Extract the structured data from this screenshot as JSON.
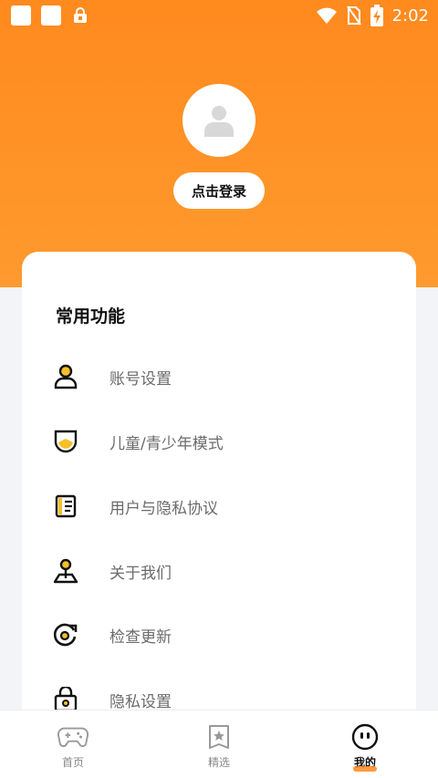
{
  "status_bar": {
    "time": "2:02",
    "icons": [
      "notification-square-icon",
      "notification-square-icon",
      "lock-app-icon",
      "wifi-icon",
      "no-sim-icon",
      "battery-charging-icon"
    ]
  },
  "profile": {
    "login_label": "点击登录",
    "avatar_icon": "user-placeholder-icon"
  },
  "common_functions": {
    "title": "常用功能",
    "items": [
      {
        "label": "账号设置",
        "icon": "person-icon"
      },
      {
        "label": "儿童/青少年模式",
        "icon": "shield-icon"
      },
      {
        "label": "用户与隐私协议",
        "icon": "document-icon"
      },
      {
        "label": "关于我们",
        "icon": "location-pin-icon"
      },
      {
        "label": "检查更新",
        "icon": "refresh-icon"
      },
      {
        "label": "隐私设置",
        "icon": "lock-icon"
      }
    ]
  },
  "tab_bar": {
    "tabs": [
      {
        "label": "首页",
        "icon": "gamepad-icon",
        "active": false
      },
      {
        "label": "精选",
        "icon": "star-card-icon",
        "active": false
      },
      {
        "label": "我的",
        "icon": "face-icon",
        "active": true
      }
    ]
  },
  "colors": {
    "accent": "#ff8a1e",
    "icon_yellow": "#f5c02a",
    "text_primary": "#111111",
    "text_secondary": "#6b6b6b"
  }
}
